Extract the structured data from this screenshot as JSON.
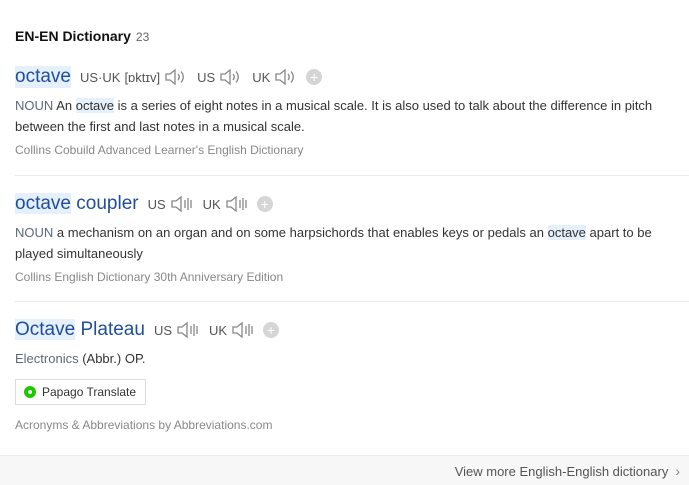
{
  "header": {
    "title": "EN-EN Dictionary",
    "count": "23"
  },
  "entries": [
    {
      "word": "octave",
      "pron": [
        {
          "label": "US·UK",
          "phonetic": "[ɒktɪv]"
        },
        {
          "label": "US"
        },
        {
          "label": "UK"
        }
      ],
      "pos": "NOUN",
      "definition": {
        "pre": "An",
        "hl": "octave",
        "post": "is a series of eight notes in a musical scale. It is also used to talk about the difference in pitch between the first and last notes in a musical scale."
      },
      "source": "Collins Cobuild Advanced Learner's English Dictionary"
    },
    {
      "word_hl": "octave",
      "word_rest": "coupler",
      "pron": [
        {
          "label": "US"
        },
        {
          "label": "UK"
        }
      ],
      "pos": "NOUN",
      "definition": {
        "pre": "a mechanism on an organ and on some harpsichords that enables keys or pedals an",
        "hl": "octave",
        "post": "apart to be played simultaneously"
      },
      "source": "Collins English Dictionary 30th Anniversary Edition"
    },
    {
      "word_hl": "Octave",
      "word_rest": "Plateau",
      "pron": [
        {
          "label": "US"
        },
        {
          "label": "UK"
        }
      ],
      "category": "Electronics",
      "definition": {
        "text": "(Abbr.) OP."
      },
      "papago_label": "Papago Translate",
      "source": "Acronyms & Abbreviations by Abbreviations.com"
    }
  ],
  "footer": {
    "link": "View more English-English dictionary"
  },
  "icons": {
    "speaker": "speaker-icon",
    "add": "plus-icon",
    "papago": "papago-icon",
    "chevron": "chevron-right-icon"
  },
  "colors": {
    "word": "#1f4e9c",
    "highlight": "#e6f0fb",
    "papago": "#1ec800"
  }
}
